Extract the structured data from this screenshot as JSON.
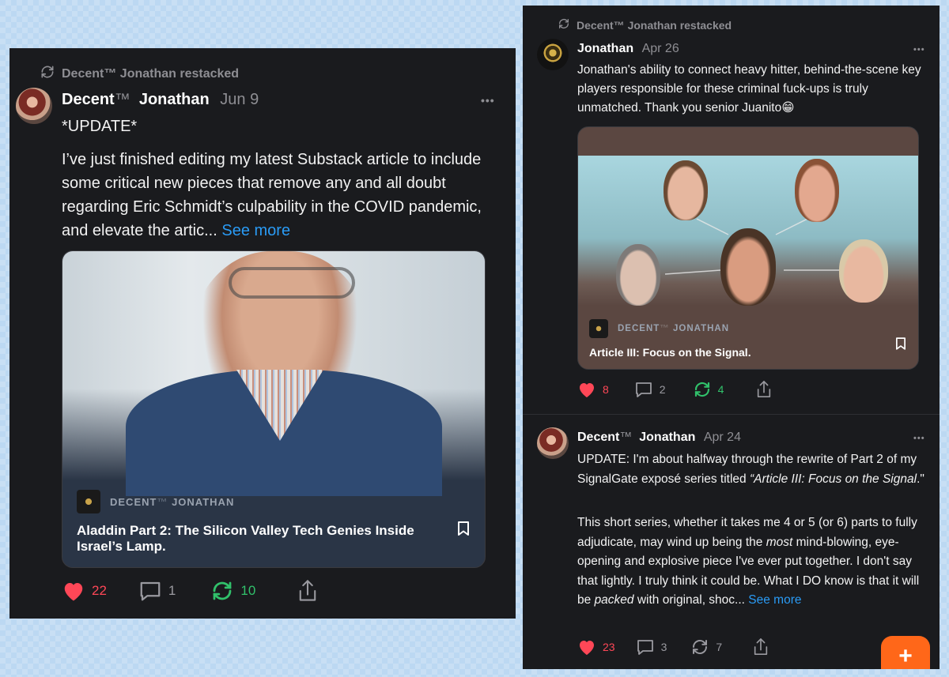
{
  "left_post": {
    "restack_text": "Decent™ Jonathan restacked",
    "author_first": "Decent",
    "author_tm": "™",
    "author_last": "Jonathan",
    "date": "Jun 9",
    "more": "•••",
    "headline": "*UPDATE*",
    "body": "I’ve just finished editing my latest Substack article to include some critical new pieces that remove any and all doubt regarding Eric Schmidt’s culpability in the COVID pandemic, and elevate the artic...",
    "see_more": "See more",
    "card": {
      "pub_first": "DECENT",
      "pub_tm": "™",
      "pub_last": "JONATHAN",
      "title": "Aladdin Part 2: The Silicon Valley Tech Genies Inside Israel’s Lamp."
    },
    "likes": "22",
    "comments": "1",
    "restacks": "10"
  },
  "right_top_post": {
    "restack_text": "Decent™ Jonathan restacked",
    "author": "Jonathan",
    "date": "Apr 26",
    "more": "•••",
    "body": "Jonathan's ability to connect heavy hitter, behind-the-scene key players responsible for these criminal fuck-ups is truly unmatched.  Thank you senior Juanito😁",
    "card": {
      "pub_first": "DECENT",
      "pub_tm": "™",
      "pub_last": "JONATHAN",
      "title": "Article III: Focus on the Signal."
    },
    "likes": "8",
    "comments": "2",
    "restacks": "4"
  },
  "right_bottom_post": {
    "author_first": "Decent",
    "author_tm": "™",
    "author_last": "Jonathan",
    "date": "Apr 24",
    "more": "•••",
    "p1_a": "UPDATE: I'm about halfway through the rewrite of Part 2 of my SignalGate exposé series titled ",
    "p1_italic": "“Article III: Focus on the Signal",
    "p1_b": ".\"",
    "p2_a": "This short series, whether it takes me 4 or 5 (or 6) parts to fully adjudicate, may wind up being the ",
    "p2_most": "most",
    "p2_b": " mind-blowing, eye-opening and explosive piece I've ever put together. I don't say that lightly. I truly think it could be. What I DO know is that it will be ",
    "p2_packed": "packed",
    "p2_c": " with original, shoc...",
    "see_more": "See more",
    "likes": "23",
    "comments": "3",
    "restacks": "7",
    "fab": "+"
  },
  "colors": {
    "panel_bg": "#1a1b1e",
    "like_red": "#ff4757",
    "restack_green": "#31c16b",
    "link_blue": "#2a9bf5",
    "fab_orange": "#ff6719"
  }
}
